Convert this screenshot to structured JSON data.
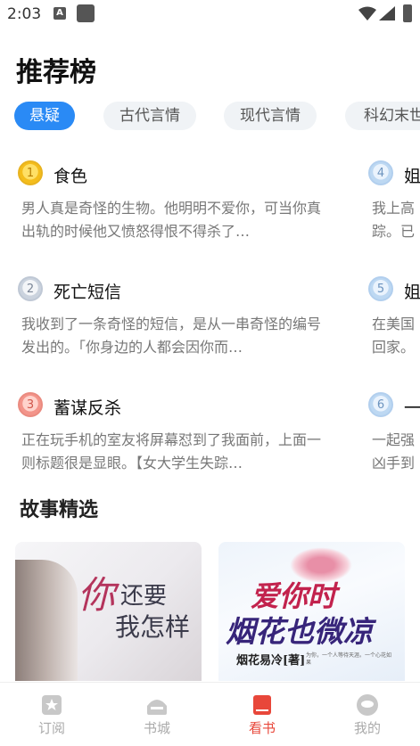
{
  "status_bar": {
    "time": "2:03",
    "notif_letter": "A"
  },
  "page_title": "推荐榜",
  "tabs": [
    {
      "label": "悬疑",
      "active": true
    },
    {
      "label": "古代言情",
      "active": false
    },
    {
      "label": "现代言情",
      "active": false
    },
    {
      "label": "科幻末世",
      "active": false
    }
  ],
  "rankings": [
    {
      "rank": "1",
      "title": "食色",
      "desc": "男人真是奇怪的生物。他明明不爱你，可当你真出轨的时候他又愤怒得恨不得杀了…"
    },
    {
      "rank": "2",
      "title": "死亡短信",
      "desc": "我收到了一条奇怪的短信，是从一串奇怪的编号发出的。「你身边的人都会因你而…"
    },
    {
      "rank": "3",
      "title": "蓄谋反杀",
      "desc": "正在玩手机的室友将屏幕怼到了我面前，上面一则标题很是显眼。【女大学生失踪…"
    },
    {
      "rank": "4",
      "title": "姐",
      "desc": "我上高踪。已经"
    },
    {
      "rank": "5",
      "title": "姐",
      "desc": "在美国回家。"
    },
    {
      "rank": "6",
      "title": "一",
      "desc": "一起强凶手到"
    }
  ],
  "section_title": "故事精选",
  "stories": [
    {
      "cover_text_1": "你",
      "cover_text_2": "还要",
      "cover_text_3": "我怎样"
    },
    {
      "cover_text_1": "爱你时",
      "cover_text_2": "烟花也微凉",
      "cover_text_3": "烟花易冷[著]",
      "cover_tagline": "为你，一个人等待天涯。一个心花如果"
    }
  ],
  "bottom_nav": [
    {
      "label": "订阅",
      "icon": "star-bookmark-icon",
      "active": false
    },
    {
      "label": "书城",
      "icon": "bookstore-icon",
      "active": false
    },
    {
      "label": "看书",
      "icon": "read-book-icon",
      "active": true
    },
    {
      "label": "我的",
      "icon": "profile-icon",
      "active": false
    }
  ],
  "colors": {
    "accent": "#2a8af5",
    "nav_active": "#e8473a"
  }
}
